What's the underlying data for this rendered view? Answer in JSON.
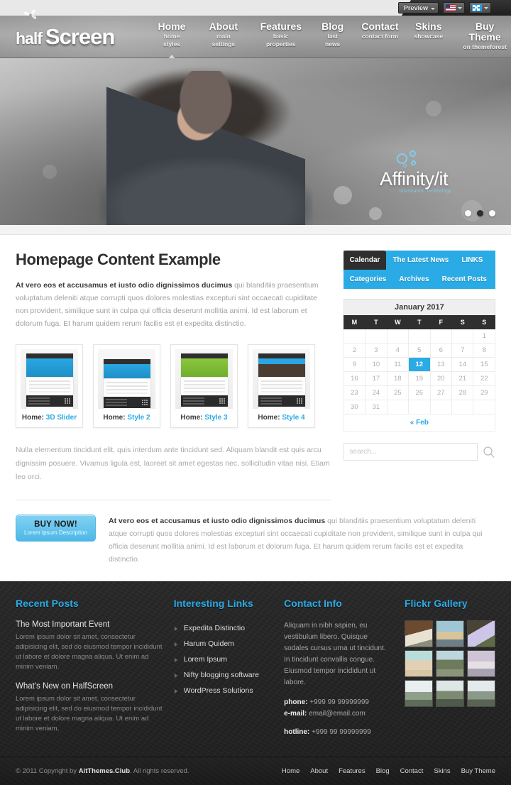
{
  "topbar": {
    "preview_label": "Preview",
    "flag_us_icon": "flag-us-icon",
    "flag_blue_icon": "flag-blue-icon",
    "chevron_icon": "chevron-down-icon"
  },
  "header": {
    "logo_mark_icon": "pinwheel-logo-icon",
    "logo_half": "half",
    "logo_screen": "Screen",
    "nav": [
      {
        "title": "Home",
        "sub": "home styles",
        "active": true
      },
      {
        "title": "About",
        "sub": "main settings",
        "active": false
      },
      {
        "title": "Features",
        "sub": "basic properties",
        "active": false
      },
      {
        "title": "Blog",
        "sub": "last news",
        "active": false
      },
      {
        "title": "Contact",
        "sub": "contact form",
        "active": false
      },
      {
        "title": "Skins",
        "sub": "showcase",
        "active": false
      },
      {
        "title": "Buy Theme",
        "sub": "on themeforest",
        "active": false
      }
    ]
  },
  "hero": {
    "watermark_name": "Affinity/it",
    "watermark_sub": "Information Technology",
    "dots": 3,
    "active_dot": 2
  },
  "content": {
    "title": "Homepage Content Example",
    "lead_bold": "At vero eos et accusamus et iusto odio dignissimos ducimus",
    "lead_rest": " qui blanditiis praesentium voluptatum deleniti atque corrupti quos dolores molestias excepturi sint occaecati cupiditate non provident, similique sunt in culpa qui officia deserunt mollitia animi. Id est laborum et dolorum fuga. Et harum quidem rerum facilis est et expedita distinctio.",
    "thumbs": [
      {
        "prefix": "Home:",
        "style": "3D Slider"
      },
      {
        "prefix": "Home:",
        "style": "Style 2"
      },
      {
        "prefix": "Home:",
        "style": "Style 3"
      },
      {
        "prefix": "Home:",
        "style": "Style 4"
      }
    ],
    "note": "Nulla elementum tincidunt elit, quis interdum ante tincidunt sed. Aliquam blandit est quis arcu dignissim posuere. Vivamus ligula est, laoreet sit amet egestas nec, sollicitudin vitae nisi. Etiam leo orci."
  },
  "sidebar": {
    "tabs": [
      {
        "label": "Calendar",
        "active": true
      },
      {
        "label": "The Latest News",
        "active": false
      },
      {
        "label": "LINKS",
        "active": false
      },
      {
        "label": "Categories",
        "active": false
      },
      {
        "label": "Archives",
        "active": false
      },
      {
        "label": "Recent Posts",
        "active": false
      }
    ],
    "calendar": {
      "caption": "January 2017",
      "weekdays": [
        "M",
        "T",
        "W",
        "T",
        "F",
        "S",
        "S"
      ],
      "weeks": [
        [
          "",
          "",
          "",
          "",
          "",
          "",
          "1"
        ],
        [
          "2",
          "3",
          "4",
          "5",
          "6",
          "7",
          "8"
        ],
        [
          "9",
          "10",
          "11",
          "12",
          "13",
          "14",
          "15"
        ],
        [
          "16",
          "17",
          "18",
          "19",
          "20",
          "21",
          "22"
        ],
        [
          "23",
          "24",
          "25",
          "26",
          "27",
          "28",
          "29"
        ],
        [
          "30",
          "31",
          "",
          "",
          "",
          "",
          ""
        ]
      ],
      "today": "12",
      "prev_link": "« Feb"
    },
    "search": {
      "placeholder": "search...",
      "value": "",
      "icon": "search-icon"
    }
  },
  "cta": {
    "button_title": "BUY NOW!",
    "button_sub": "Lorem Ipsum Description",
    "text_bold": "At vero eos et accusamus et iusto odio dignissimos ducimus",
    "text_rest": " qui blanditiis praesentium voluptatum deleniti atque corrupti quos dolores molestias excepturi sint occaecati cupiditate non provident, similique sunt in culpa qui officia deserunt mollitia animi. Id est laborum et dolorum fuga. Et harum quidem rerum facilis est et expedita distinctio."
  },
  "footer": {
    "recent_posts": {
      "title": "Recent Posts",
      "items": [
        {
          "title": "The Most Important Event",
          "body": "Lorem ipsum dolor sit amet, consectetur adipisicing elit, sed do eiusmod tempor incididunt ut labore et dolore magna aliqua. Ut enim ad minim veniam."
        },
        {
          "title": "What's New on HalfScreen",
          "body": "Lorem ipsum dolor sit amet, consectetur adipisicing elit, sed do eiusmod tempor incididunt ut labore et dolore magna aliqua. Ut enim ad minim veniam,"
        }
      ]
    },
    "interesting_links": {
      "title": "Interesting Links",
      "items": [
        "Expedita Distinctio",
        "Harum Quidem",
        "Lorem Ipsum",
        "Nifty blogging software",
        "WordPress Solutions"
      ]
    },
    "contact_info": {
      "title": "Contact Info",
      "body": "Aliquam in nibh sapien, eu vestibulum libero. Quisque sodales cursus urna ut tincidunt. In tincidunt convallis congue. Eiusmod tempor incididunt ut labore.",
      "phone_label": "phone:",
      "phone_value": "+999 99 99999999",
      "email_label": "e-mail:",
      "email_value": "email@email.com",
      "hotline_label": "hotline:",
      "hotline_value": "+999 99 99999999"
    },
    "flickr": {
      "title": "Flickr Gallery",
      "thumbs": [
        "car-cabin-photo",
        "beach-horizon-photo",
        "lilac-flowers-photo",
        "desert-sand-photo",
        "coast-cliff-photo",
        "lake-people-photo",
        "misty-forest-photo",
        "foggy-bridge-photo",
        "mountain-mist-photo"
      ]
    }
  },
  "copyright": {
    "prefix": "© 2011 Copyright by ",
    "brand": "AitThemes.Club",
    "suffix": ". All rights reserved.",
    "links": [
      "Home",
      "About",
      "Features",
      "Blog",
      "Contact",
      "Skins",
      "Buy Theme"
    ]
  },
  "colors": {
    "accent": "#2babe5",
    "dark": "#2f2f2f",
    "footer_bg": "#262626",
    "body_text": "#a0a0a0"
  }
}
